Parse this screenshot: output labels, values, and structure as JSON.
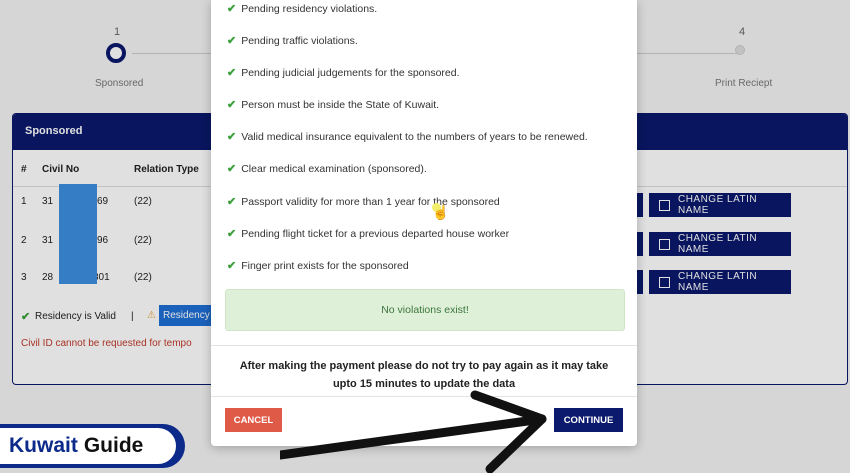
{
  "steps": [
    {
      "number": "1",
      "label": "Sponsored"
    },
    {
      "number": "4",
      "label": "Print Reciept"
    }
  ],
  "panel": {
    "title": "Sponsored",
    "columns": [
      "#",
      "Civil No",
      "Relation Type"
    ],
    "rows": [
      {
        "index": "1",
        "civil_prefix": "31",
        "civil_suffix": "69",
        "relation": "(22)"
      },
      {
        "index": "2",
        "civil_prefix": "31",
        "civil_suffix": "96",
        "relation": "(22)"
      },
      {
        "index": "3",
        "civil_prefix": "28",
        "civil_suffix": "801",
        "relation": "(22)"
      }
    ],
    "row_button_label": "CHANGE LATIN NAME",
    "residency_valid": "Residency is Valid",
    "separator": "|",
    "residency_badge": "Residency",
    "civil_id_warning": "Civil ID cannot be requested for tempo"
  },
  "modal": {
    "checks": [
      "Pending residency violations.",
      "Pending traffic violations.",
      "Pending judicial judgements for the sponsored.",
      "Person must be inside the State of Kuwait.",
      "Valid medical insurance equivalent to the numbers of years to be renewed.",
      "Clear medical examination (sponsored).",
      "Passport validity for more than 1 year for the sponsored",
      "Pending flight ticket for a previous departed house worker",
      "Finger print exists for the sponsored"
    ],
    "status": "No violations exist!",
    "note": "After making the payment please do not try to pay again as it may take upto 15 minutes to update the data",
    "cancel_label": "CANCEL",
    "continue_label": "CONTINUE"
  },
  "logo": {
    "part1": "Kuwait",
    "part2": "Guide"
  },
  "colors": {
    "primary": "#0b1a6d",
    "success": "#3aa03a",
    "danger": "#e05a48",
    "info_bg": "#dff0d8",
    "warning": "#e6a23c"
  }
}
